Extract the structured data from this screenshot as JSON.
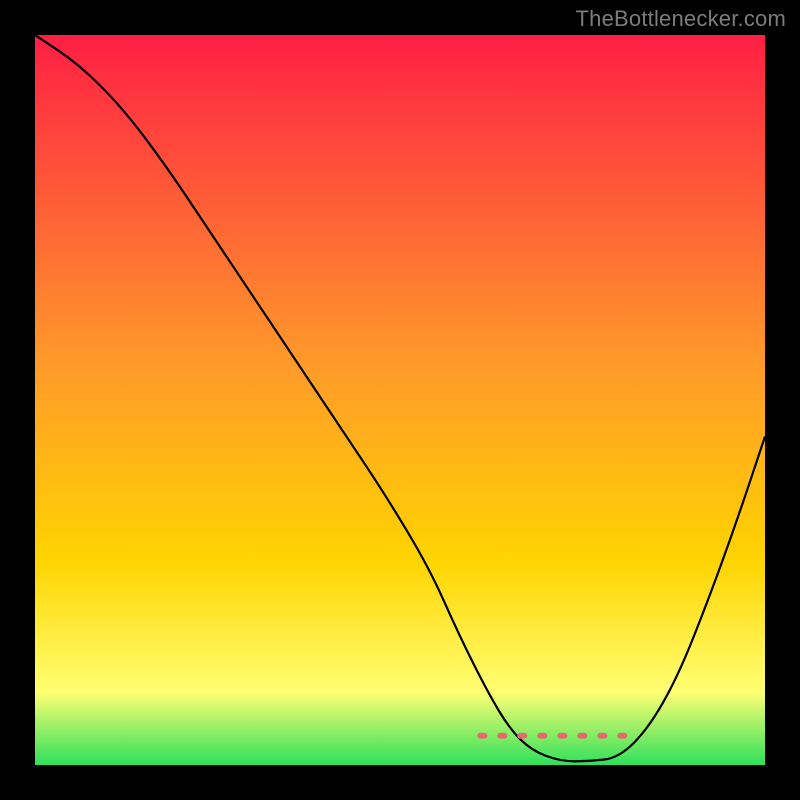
{
  "watermark": "TheBottlenecker.com",
  "colors": {
    "background": "#000000",
    "gradient_top": "#ff1f44",
    "gradient_mid": "#ffd400",
    "gradient_low": "#ffff73",
    "gradient_bottom": "#2fe05b",
    "curve": "#000000",
    "dash": "#e36a6a"
  },
  "chart_data": {
    "type": "line",
    "title": "",
    "xlabel": "",
    "ylabel": "",
    "xlim": [
      0,
      100
    ],
    "ylim": [
      0,
      100
    ],
    "legend_position": "none",
    "grid": false,
    "series": [
      {
        "name": "curve",
        "x": [
          0,
          6,
          12,
          18,
          24,
          30,
          36,
          42,
          48,
          54,
          58,
          62,
          65,
          68,
          72,
          76,
          80,
          84,
          88,
          92,
          96,
          100
        ],
        "values": [
          100,
          96,
          90,
          82,
          73,
          64,
          55,
          46,
          37,
          27,
          18,
          10,
          5,
          2,
          0.5,
          0.5,
          1,
          5,
          12,
          22,
          33,
          45
        ]
      }
    ],
    "dash_region_x": [
      61,
      81
    ],
    "dash_region_y": 4
  }
}
